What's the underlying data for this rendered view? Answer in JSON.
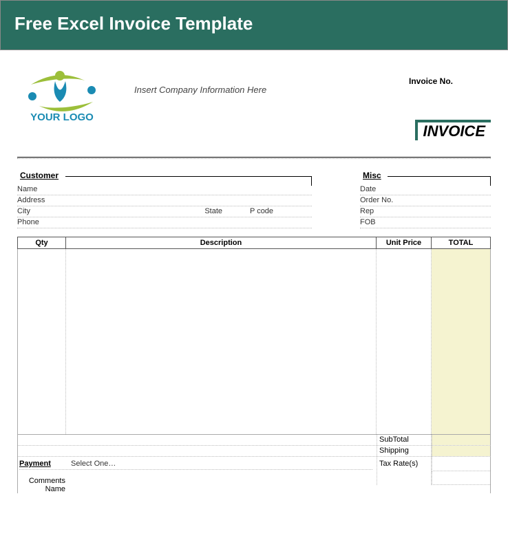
{
  "header": {
    "title": "Free Excel Invoice Template"
  },
  "logo": {
    "text": "YOUR LOGO"
  },
  "company_info": "Insert Company Information Here",
  "invoice_no_label": "Invoice No.",
  "invoice_label": "INVOICE",
  "customer": {
    "heading": "Customer",
    "name_label": "Name",
    "address_label": "Address",
    "city_label": "City",
    "state_label": "State",
    "pcode_label": "P code",
    "phone_label": "Phone"
  },
  "misc": {
    "heading": "Misc",
    "date_label": "Date",
    "order_no_label": "Order No.",
    "rep_label": "Rep",
    "fob_label": "FOB"
  },
  "table": {
    "qty": "Qty",
    "description": "Description",
    "unit_price": "Unit Price",
    "total": "TOTAL"
  },
  "summary": {
    "subtotal": "SubTotal",
    "shipping": "Shipping",
    "tax_rates": "Tax Rate(s)"
  },
  "payment": {
    "label": "Payment",
    "value": "Select One…"
  },
  "comments": {
    "label": "Comments",
    "name_label": "Name"
  }
}
